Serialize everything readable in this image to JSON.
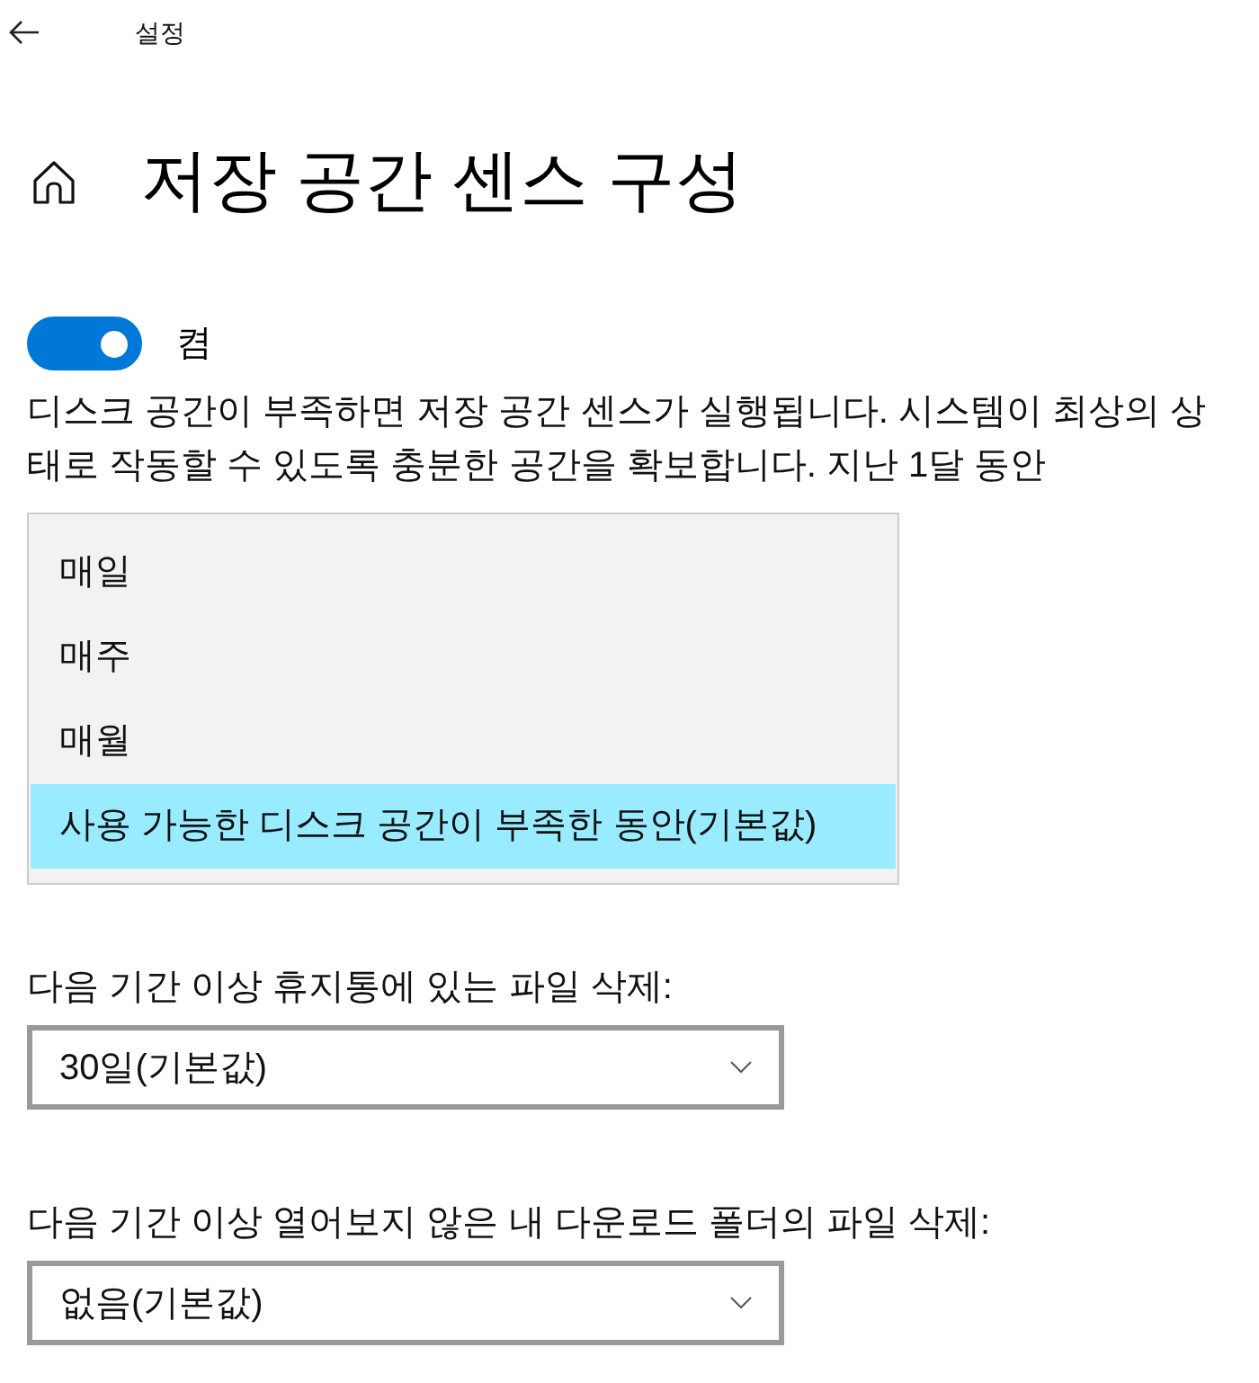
{
  "nav": {
    "title": "설정"
  },
  "page": {
    "title": "저장 공간 센스 구성"
  },
  "toggle": {
    "on": true,
    "label": "켬"
  },
  "description": "디스크 공간이 부족하면 저장 공간 센스가 실행됩니다. 시스템이 최상의 상태로 작동할 수 있도록 충분한 공간을 확보합니다. 지난 1달 동안",
  "run_menu": {
    "options": [
      {
        "label": "매일",
        "selected": false
      },
      {
        "label": "매주",
        "selected": false
      },
      {
        "label": "매월",
        "selected": false
      },
      {
        "label": "사용 가능한 디스크 공간이 부족한 동안(기본값)",
        "selected": true
      }
    ]
  },
  "settings": [
    {
      "label": "다음 기간 이상 휴지통에 있는 파일 삭제:",
      "value": "30일(기본값)"
    },
    {
      "label": "다음 기간 이상 열어보지 않은 내 다운로드 폴더의 파일 삭제:",
      "value": "없음(기본값)"
    }
  ]
}
